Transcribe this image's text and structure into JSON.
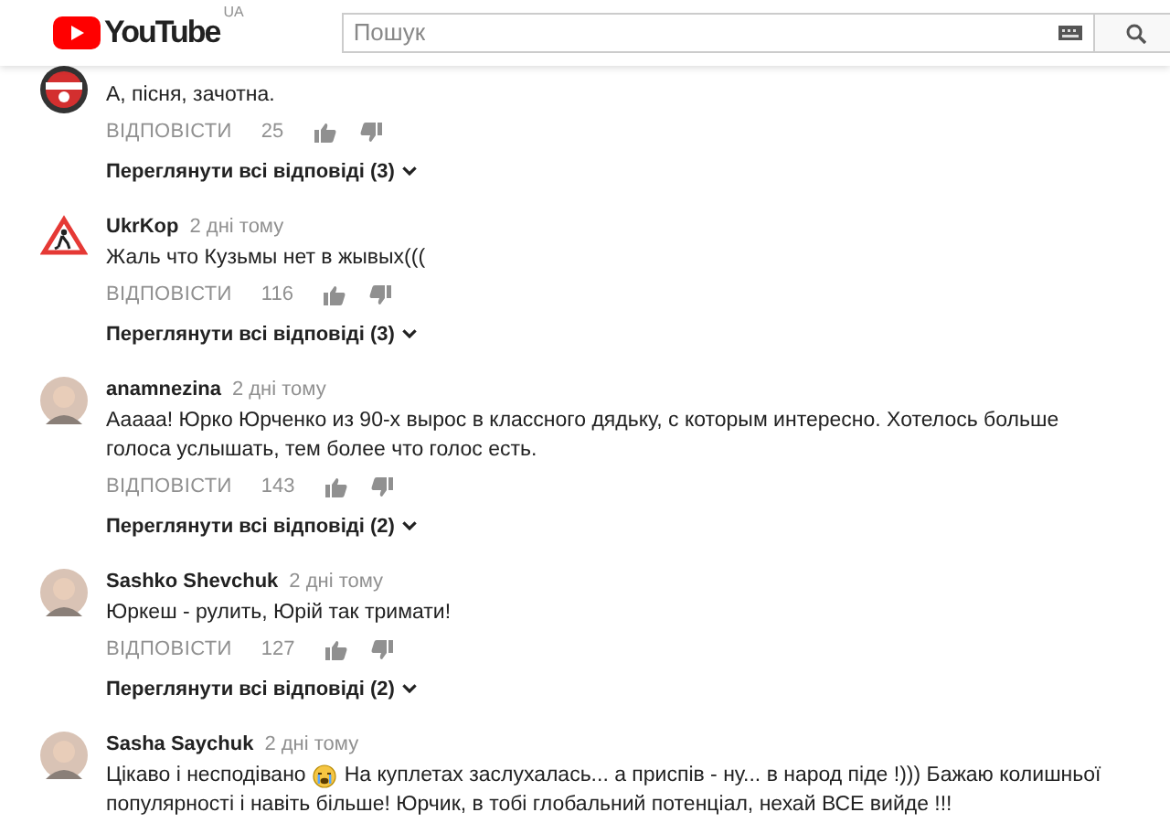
{
  "header": {
    "logo_text": "YouTube",
    "region": "UA",
    "search": {
      "placeholder": "Пошук"
    }
  },
  "comments": [
    {
      "text": [
        "А, пісня, зачотна."
      ],
      "reply": "ВІДПОВІСТИ",
      "likes": "25",
      "view_replies": "Переглянути всі відповіді (3)"
    },
    {
      "author": "UkrKop",
      "time": "2 дні тому",
      "text": [
        "Жаль что Кузьмы нет в жывых((("
      ],
      "reply": "ВІДПОВІСТИ",
      "likes": "116",
      "view_replies": "Переглянути всі відповіді (3)"
    },
    {
      "author": "anamnezina",
      "time": "2 дні тому",
      "text": [
        "Ааааа! Юрко Юрченко из 90-х вырос в классного дядьку, с которым интересно. Хотелось больше голоса услышать, тем более что голос есть."
      ],
      "reply": "ВІДПОВІСТИ",
      "likes": "143",
      "view_replies": "Переглянути всі відповіді (2)"
    },
    {
      "author": "Sashko Shevchuk",
      "time": "2 дні тому",
      "text": [
        "Юркеш - рулить, Юрій так тримати!"
      ],
      "reply": "ВІДПОВІСТИ",
      "likes": "127",
      "view_replies": "Переглянути всі відповіді (2)"
    },
    {
      "author": "Sasha Saychuk",
      "time": "2 дні тому",
      "text": [
        "Цікаво і несподівано",
        "На куплетах заслухалась... а приспів - ну... в народ піде !))) Бажаю колишньої",
        "популярності і навіть більше! Юрчик, в тобі глобальний потенціал, нехай ВСЕ вийде !!!"
      ]
    }
  ]
}
